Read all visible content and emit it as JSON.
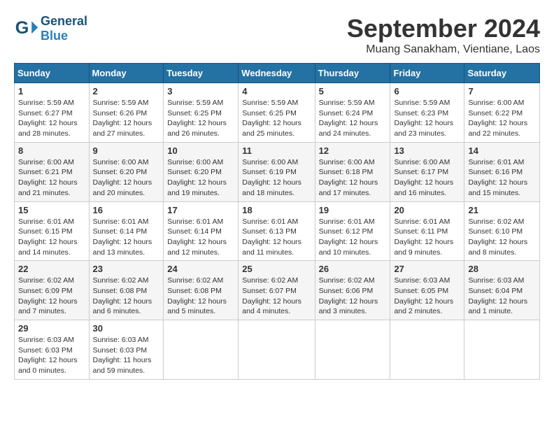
{
  "header": {
    "logo_general": "General",
    "logo_blue": "Blue",
    "month_title": "September 2024",
    "location": "Muang Sanakham, Vientiane, Laos"
  },
  "weekdays": [
    "Sunday",
    "Monday",
    "Tuesday",
    "Wednesday",
    "Thursday",
    "Friday",
    "Saturday"
  ],
  "weeks": [
    [
      {
        "day": "1",
        "sunrise": "5:59 AM",
        "sunset": "6:27 PM",
        "daylight": "12 hours and 28 minutes."
      },
      {
        "day": "2",
        "sunrise": "5:59 AM",
        "sunset": "6:26 PM",
        "daylight": "12 hours and 27 minutes."
      },
      {
        "day": "3",
        "sunrise": "5:59 AM",
        "sunset": "6:25 PM",
        "daylight": "12 hours and 26 minutes."
      },
      {
        "day": "4",
        "sunrise": "5:59 AM",
        "sunset": "6:25 PM",
        "daylight": "12 hours and 25 minutes."
      },
      {
        "day": "5",
        "sunrise": "5:59 AM",
        "sunset": "6:24 PM",
        "daylight": "12 hours and 24 minutes."
      },
      {
        "day": "6",
        "sunrise": "5:59 AM",
        "sunset": "6:23 PM",
        "daylight": "12 hours and 23 minutes."
      },
      {
        "day": "7",
        "sunrise": "6:00 AM",
        "sunset": "6:22 PM",
        "daylight": "12 hours and 22 minutes."
      }
    ],
    [
      {
        "day": "8",
        "sunrise": "6:00 AM",
        "sunset": "6:21 PM",
        "daylight": "12 hours and 21 minutes."
      },
      {
        "day": "9",
        "sunrise": "6:00 AM",
        "sunset": "6:20 PM",
        "daylight": "12 hours and 20 minutes."
      },
      {
        "day": "10",
        "sunrise": "6:00 AM",
        "sunset": "6:20 PM",
        "daylight": "12 hours and 19 minutes."
      },
      {
        "day": "11",
        "sunrise": "6:00 AM",
        "sunset": "6:19 PM",
        "daylight": "12 hours and 18 minutes."
      },
      {
        "day": "12",
        "sunrise": "6:00 AM",
        "sunset": "6:18 PM",
        "daylight": "12 hours and 17 minutes."
      },
      {
        "day": "13",
        "sunrise": "6:00 AM",
        "sunset": "6:17 PM",
        "daylight": "12 hours and 16 minutes."
      },
      {
        "day": "14",
        "sunrise": "6:01 AM",
        "sunset": "6:16 PM",
        "daylight": "12 hours and 15 minutes."
      }
    ],
    [
      {
        "day": "15",
        "sunrise": "6:01 AM",
        "sunset": "6:15 PM",
        "daylight": "12 hours and 14 minutes."
      },
      {
        "day": "16",
        "sunrise": "6:01 AM",
        "sunset": "6:14 PM",
        "daylight": "12 hours and 13 minutes."
      },
      {
        "day": "17",
        "sunrise": "6:01 AM",
        "sunset": "6:14 PM",
        "daylight": "12 hours and 12 minutes."
      },
      {
        "day": "18",
        "sunrise": "6:01 AM",
        "sunset": "6:13 PM",
        "daylight": "12 hours and 11 minutes."
      },
      {
        "day": "19",
        "sunrise": "6:01 AM",
        "sunset": "6:12 PM",
        "daylight": "12 hours and 10 minutes."
      },
      {
        "day": "20",
        "sunrise": "6:01 AM",
        "sunset": "6:11 PM",
        "daylight": "12 hours and 9 minutes."
      },
      {
        "day": "21",
        "sunrise": "6:02 AM",
        "sunset": "6:10 PM",
        "daylight": "12 hours and 8 minutes."
      }
    ],
    [
      {
        "day": "22",
        "sunrise": "6:02 AM",
        "sunset": "6:09 PM",
        "daylight": "12 hours and 7 minutes."
      },
      {
        "day": "23",
        "sunrise": "6:02 AM",
        "sunset": "6:08 PM",
        "daylight": "12 hours and 6 minutes."
      },
      {
        "day": "24",
        "sunrise": "6:02 AM",
        "sunset": "6:08 PM",
        "daylight": "12 hours and 5 minutes."
      },
      {
        "day": "25",
        "sunrise": "6:02 AM",
        "sunset": "6:07 PM",
        "daylight": "12 hours and 4 minutes."
      },
      {
        "day": "26",
        "sunrise": "6:02 AM",
        "sunset": "6:06 PM",
        "daylight": "12 hours and 3 minutes."
      },
      {
        "day": "27",
        "sunrise": "6:03 AM",
        "sunset": "6:05 PM",
        "daylight": "12 hours and 2 minutes."
      },
      {
        "day": "28",
        "sunrise": "6:03 AM",
        "sunset": "6:04 PM",
        "daylight": "12 hours and 1 minute."
      }
    ],
    [
      {
        "day": "29",
        "sunrise": "6:03 AM",
        "sunset": "6:03 PM",
        "daylight": "12 hours and 0 minutes."
      },
      {
        "day": "30",
        "sunrise": "6:03 AM",
        "sunset": "6:03 PM",
        "daylight": "11 hours and 59 minutes."
      },
      null,
      null,
      null,
      null,
      null
    ]
  ]
}
